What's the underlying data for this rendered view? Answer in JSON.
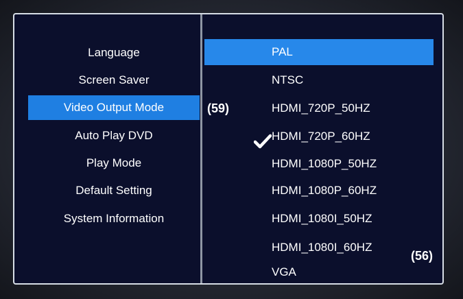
{
  "left_menu": {
    "items": [
      {
        "label": "Language"
      },
      {
        "label": "Screen Saver"
      },
      {
        "label": "Video Output Mode"
      },
      {
        "label": "Auto Play DVD"
      },
      {
        "label": "Play Mode"
      },
      {
        "label": "Default  Setting"
      },
      {
        "label": "System Information"
      }
    ],
    "selected": "Video Output Mode"
  },
  "right_menu": {
    "items": [
      {
        "label": "PAL"
      },
      {
        "label": "NTSC"
      },
      {
        "label": "HDMI_720P_50HZ"
      },
      {
        "label": "HDMI_720P_60HZ"
      },
      {
        "label": "HDMI_1080P_50HZ"
      },
      {
        "label": "HDMI_1080P_60HZ"
      },
      {
        "label": "HDMI_1080I_50HZ"
      },
      {
        "label": "HDMI_1080I_60HZ"
      },
      {
        "label": "VGA"
      }
    ],
    "highlighted": "PAL",
    "checked": "HDMI_720P_60HZ"
  },
  "annotations": {
    "left": "(59)",
    "right": "(56)"
  },
  "icons": {
    "checkmark": "checkmark-icon"
  },
  "colors": {
    "background": "#0b0f2c",
    "selection_left": "#1f7fe2",
    "selection_right": "#2788ea",
    "text": "#ffffff"
  }
}
